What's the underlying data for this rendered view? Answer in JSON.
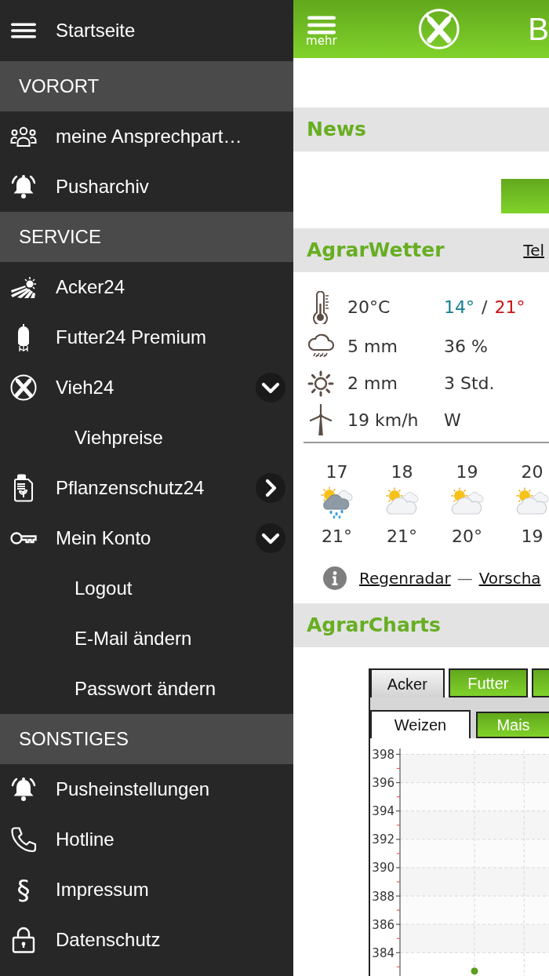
{
  "menu": {
    "home": {
      "label": "Startseite"
    },
    "sections": [
      {
        "title": "VORORT",
        "items": [
          {
            "kind": "link",
            "label": "meine Ansprechpart…"
          },
          {
            "kind": "link",
            "label": "Pusharchiv"
          }
        ]
      },
      {
        "title": "SERVICE",
        "items": [
          {
            "kind": "link",
            "label": "Acker24"
          },
          {
            "kind": "link",
            "label": "Futter24 Premium"
          },
          {
            "kind": "group",
            "label": "Vieh24",
            "expanded": true,
            "children": [
              {
                "label": "Viehpreise"
              }
            ]
          },
          {
            "kind": "group",
            "label": "Pflanzenschutz24",
            "expanded": false
          },
          {
            "kind": "group",
            "label": "Mein Konto",
            "expanded": true,
            "children": [
              {
                "label": "Logout"
              },
              {
                "label": "E-Mail ändern"
              },
              {
                "label": "Passwort ändern"
              }
            ]
          }
        ]
      },
      {
        "title": "SONSTIGES",
        "items": [
          {
            "kind": "link",
            "label": "Pusheinstellungen"
          },
          {
            "kind": "link",
            "label": "Hotline"
          },
          {
            "kind": "link",
            "label": "Impressum",
            "glyph": "§"
          },
          {
            "kind": "link",
            "label": "Datenschutz"
          }
        ]
      }
    ]
  },
  "header": {
    "menu_label": "mehr",
    "title": "B"
  },
  "news": {
    "title": "News",
    "actions": [
      {
        "kind": "button"
      }
    ]
  },
  "weather": {
    "title": "AgrarWetter",
    "location_link": "Tel",
    "current": [
      {
        "kind": "temperature",
        "value": "20°C",
        "low": "14°",
        "separator": "/",
        "high": "21°"
      },
      {
        "kind": "rain",
        "value": "5 mm",
        "extra": "36 %"
      },
      {
        "kind": "sun",
        "value": "2 mm",
        "extra": "3 Std."
      },
      {
        "kind": "wind",
        "value": "19 km/h",
        "extra": "W"
      }
    ],
    "forecast": [
      {
        "day": "17",
        "kind": "rain",
        "temp": "21°"
      },
      {
        "day": "18",
        "kind": "partly-cloudy",
        "temp": "21°"
      },
      {
        "day": "19",
        "kind": "partly-cloudy",
        "temp": "20°"
      },
      {
        "day": "20",
        "kind": "partly-cloudy",
        "temp": "19"
      }
    ],
    "links": [
      "Regenradar",
      "Vorscha"
    ],
    "link_separator": "—"
  },
  "charts": {
    "title": "AgrarCharts",
    "tabs": [
      {
        "label": "Acker",
        "selected": true
      },
      {
        "label": "Futter",
        "selected": false
      },
      {
        "selected": false
      }
    ],
    "subtabs": [
      {
        "label": "Weizen",
        "selected": true
      },
      {
        "label": "Mais",
        "selected": false
      }
    ],
    "chart_data": {
      "type": "line",
      "grid": true,
      "ylim": [
        382.3,
        398.3
      ],
      "yticks": [
        384,
        386,
        388,
        390,
        392,
        394,
        396,
        398
      ],
      "series": [
        {
          "color": "#5a9e1f",
          "marker": true,
          "values": [
            null,
            382.7,
            null
          ]
        }
      ]
    }
  }
}
